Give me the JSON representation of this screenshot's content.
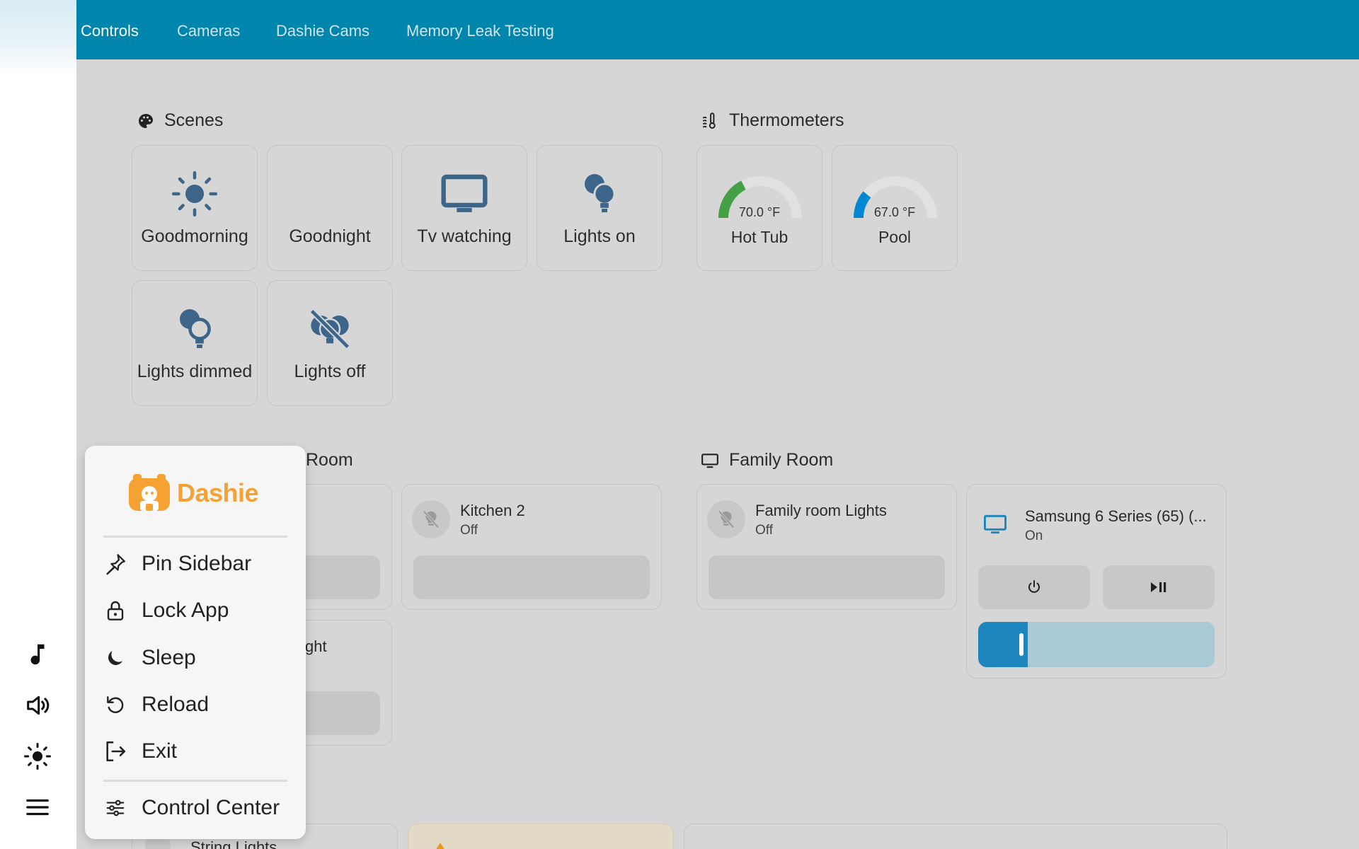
{
  "topbar": {
    "tabs": [
      {
        "label": "Controls",
        "active": true
      },
      {
        "label": "Cameras",
        "active": false
      },
      {
        "label": "Dashie Cams",
        "active": false
      },
      {
        "label": "Memory Leak Testing",
        "active": false
      }
    ]
  },
  "scenes": {
    "title": "Scenes",
    "icon": "palette-icon",
    "items": [
      {
        "label": "Goodmorning",
        "icon": "sun-icon"
      },
      {
        "label": "Goodnight",
        "icon": "moon-icon"
      },
      {
        "label": "Tv watching",
        "icon": "tv-icon"
      },
      {
        "label": "Lights on",
        "icon": "bulbs-on-icon"
      },
      {
        "label": "Lights dimmed",
        "icon": "bulb-dimmed-icon"
      },
      {
        "label": "Lights off",
        "icon": "bulbs-off-icon"
      }
    ]
  },
  "thermometers": {
    "title": "Thermometers",
    "icon": "pool-thermometer-icon",
    "items": [
      {
        "name": "Hot Tub",
        "value": "70.0 °F",
        "fraction": 0.35,
        "color": "#43a047"
      },
      {
        "name": "Pool",
        "value": "67.0 °F",
        "fraction": 0.22,
        "color": "#0288d1"
      }
    ]
  },
  "room1": {
    "title_partial": "Room",
    "light_partial_name": "ght",
    "kitchen2": {
      "name": "Kitchen 2",
      "state": "Off"
    }
  },
  "family_room": {
    "title": "Family Room",
    "icon": "monitor-icon",
    "light": {
      "name": "Family room Lights",
      "state": "Off"
    },
    "tv": {
      "name": "Samsung 6 Series (65) (...",
      "state": "On",
      "volume_fraction": 0.21
    }
  },
  "bottom_peek": {
    "label": "String Lights"
  },
  "rail": {
    "icons": [
      "music-note-icon",
      "volume-icon",
      "brightness-icon",
      "menu-icon"
    ]
  },
  "menu": {
    "logo_text": "Dashie",
    "items": [
      {
        "label": "Pin Sidebar",
        "icon": "pin-icon"
      },
      {
        "label": "Lock App",
        "icon": "lock-icon"
      },
      {
        "label": "Sleep",
        "icon": "moon-icon"
      },
      {
        "label": "Reload",
        "icon": "reload-icon"
      },
      {
        "label": "Exit",
        "icon": "exit-icon"
      },
      {
        "label": "Control Center",
        "icon": "tune-icon"
      }
    ]
  },
  "colors": {
    "topbar": "#0085ad",
    "scene_icon": "#3c6589",
    "brand": "#f5a233",
    "background": "#d6d6d6"
  }
}
